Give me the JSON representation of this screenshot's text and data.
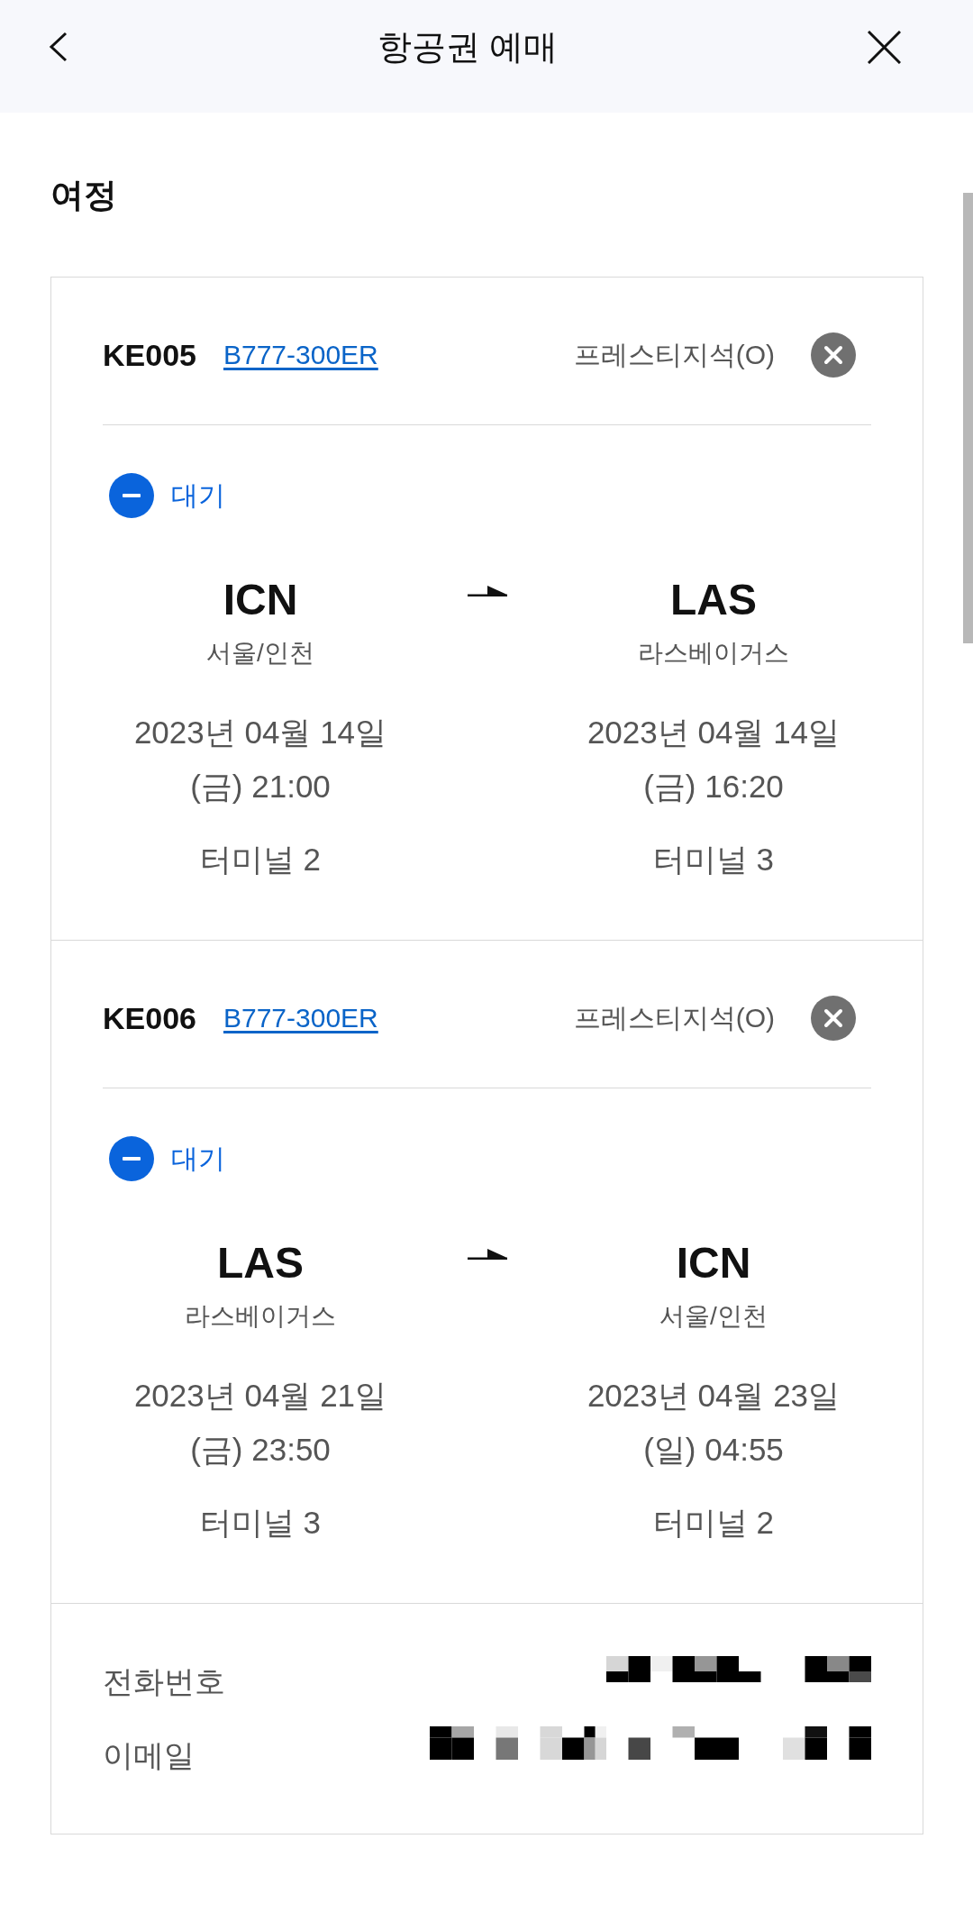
{
  "header": {
    "title": "항공권 예매"
  },
  "section": {
    "title": "여정"
  },
  "segments": [
    {
      "flight": "KE005",
      "aircraft": "B777-300ER",
      "cabin": "프레스티지석(O)",
      "status": {
        "kind": "waitlist",
        "label": "대기"
      },
      "departure": {
        "code": "ICN",
        "city": "서울/인천",
        "date": "2023년 04월 14일",
        "time": "(금) 21:00",
        "terminal": "터미널 2"
      },
      "arrival": {
        "code": "LAS",
        "city": "라스베이거스",
        "date": "2023년 04월 14일",
        "time": "(금) 16:20",
        "terminal": "터미널 3"
      }
    },
    {
      "flight": "KE006",
      "aircraft": "B777-300ER",
      "cabin": "프레스티지석(O)",
      "status": {
        "kind": "waitlist",
        "label": "대기"
      },
      "departure": {
        "code": "LAS",
        "city": "라스베이거스",
        "date": "2023년 04월 21일",
        "time": "(금) 23:50",
        "terminal": "터미널 3"
      },
      "arrival": {
        "code": "ICN",
        "city": "서울/인천",
        "date": "2023년 04월 23일",
        "time": "(일) 04:55",
        "terminal": "터미널 2"
      }
    }
  ],
  "contact": [
    {
      "kind": "phone",
      "label": "전화번호"
    },
    {
      "kind": "email",
      "label": "이메일"
    }
  ]
}
